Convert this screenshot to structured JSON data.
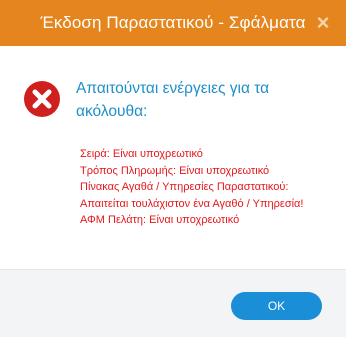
{
  "dialog": {
    "title": "Έκδοση Παραστατικού - Σφάλματα",
    "close_icon": "×",
    "error_icon": "error-x-circle-icon",
    "heading": "Απαιτούνται ενέργειες για τα ακόλουθα:",
    "errors": [
      "Σειρά: Είναι υποχρεωτικό",
      "Τρόπος Πληρωμής: Είναι υποχρεωτικό",
      "Πίνακας Αγαθά / Υπηρεσίες Παραστατικού:",
      "Απαιτείται τουλάχιστον ένα Αγαθό / Υπηρεσία!",
      "ΑΦΜ Πελάτη: Είναι υποχρεωτικό"
    ],
    "ok_label": "OK"
  },
  "colors": {
    "titlebar": "#e5851e",
    "heading": "#1e8fc8",
    "error_text": "#e4171c",
    "error_icon": "#cf1f1f",
    "ok_button": "#1a8ed6",
    "footer": "#f2f4f6"
  }
}
